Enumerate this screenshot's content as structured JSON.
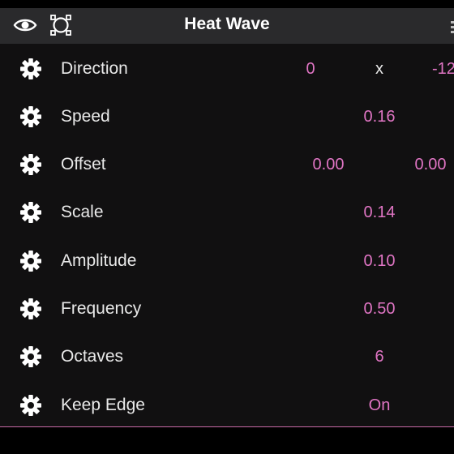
{
  "header": {
    "title": "Heat Wave",
    "visibility_icon": "eye-icon",
    "frame_icon": "frame-select-icon"
  },
  "colors": {
    "value": "#e075c4",
    "label": "#e9e9e9",
    "header_bg": "#2a2a2c",
    "panel_bg": "#111011",
    "accent_line": "#c86aa8"
  },
  "properties": [
    {
      "label": "Direction",
      "x": "0",
      "separator": "x",
      "y": "-12"
    },
    {
      "label": "Speed",
      "value": "0.16"
    },
    {
      "label": "Offset",
      "x": "0.00",
      "y": "0.00"
    },
    {
      "label": "Scale",
      "value": "0.14"
    },
    {
      "label": "Amplitude",
      "value": "0.10"
    },
    {
      "label": "Frequency",
      "value": "0.50"
    },
    {
      "label": "Octaves",
      "value": "6"
    },
    {
      "label": "Keep Edge",
      "value": "On"
    }
  ]
}
